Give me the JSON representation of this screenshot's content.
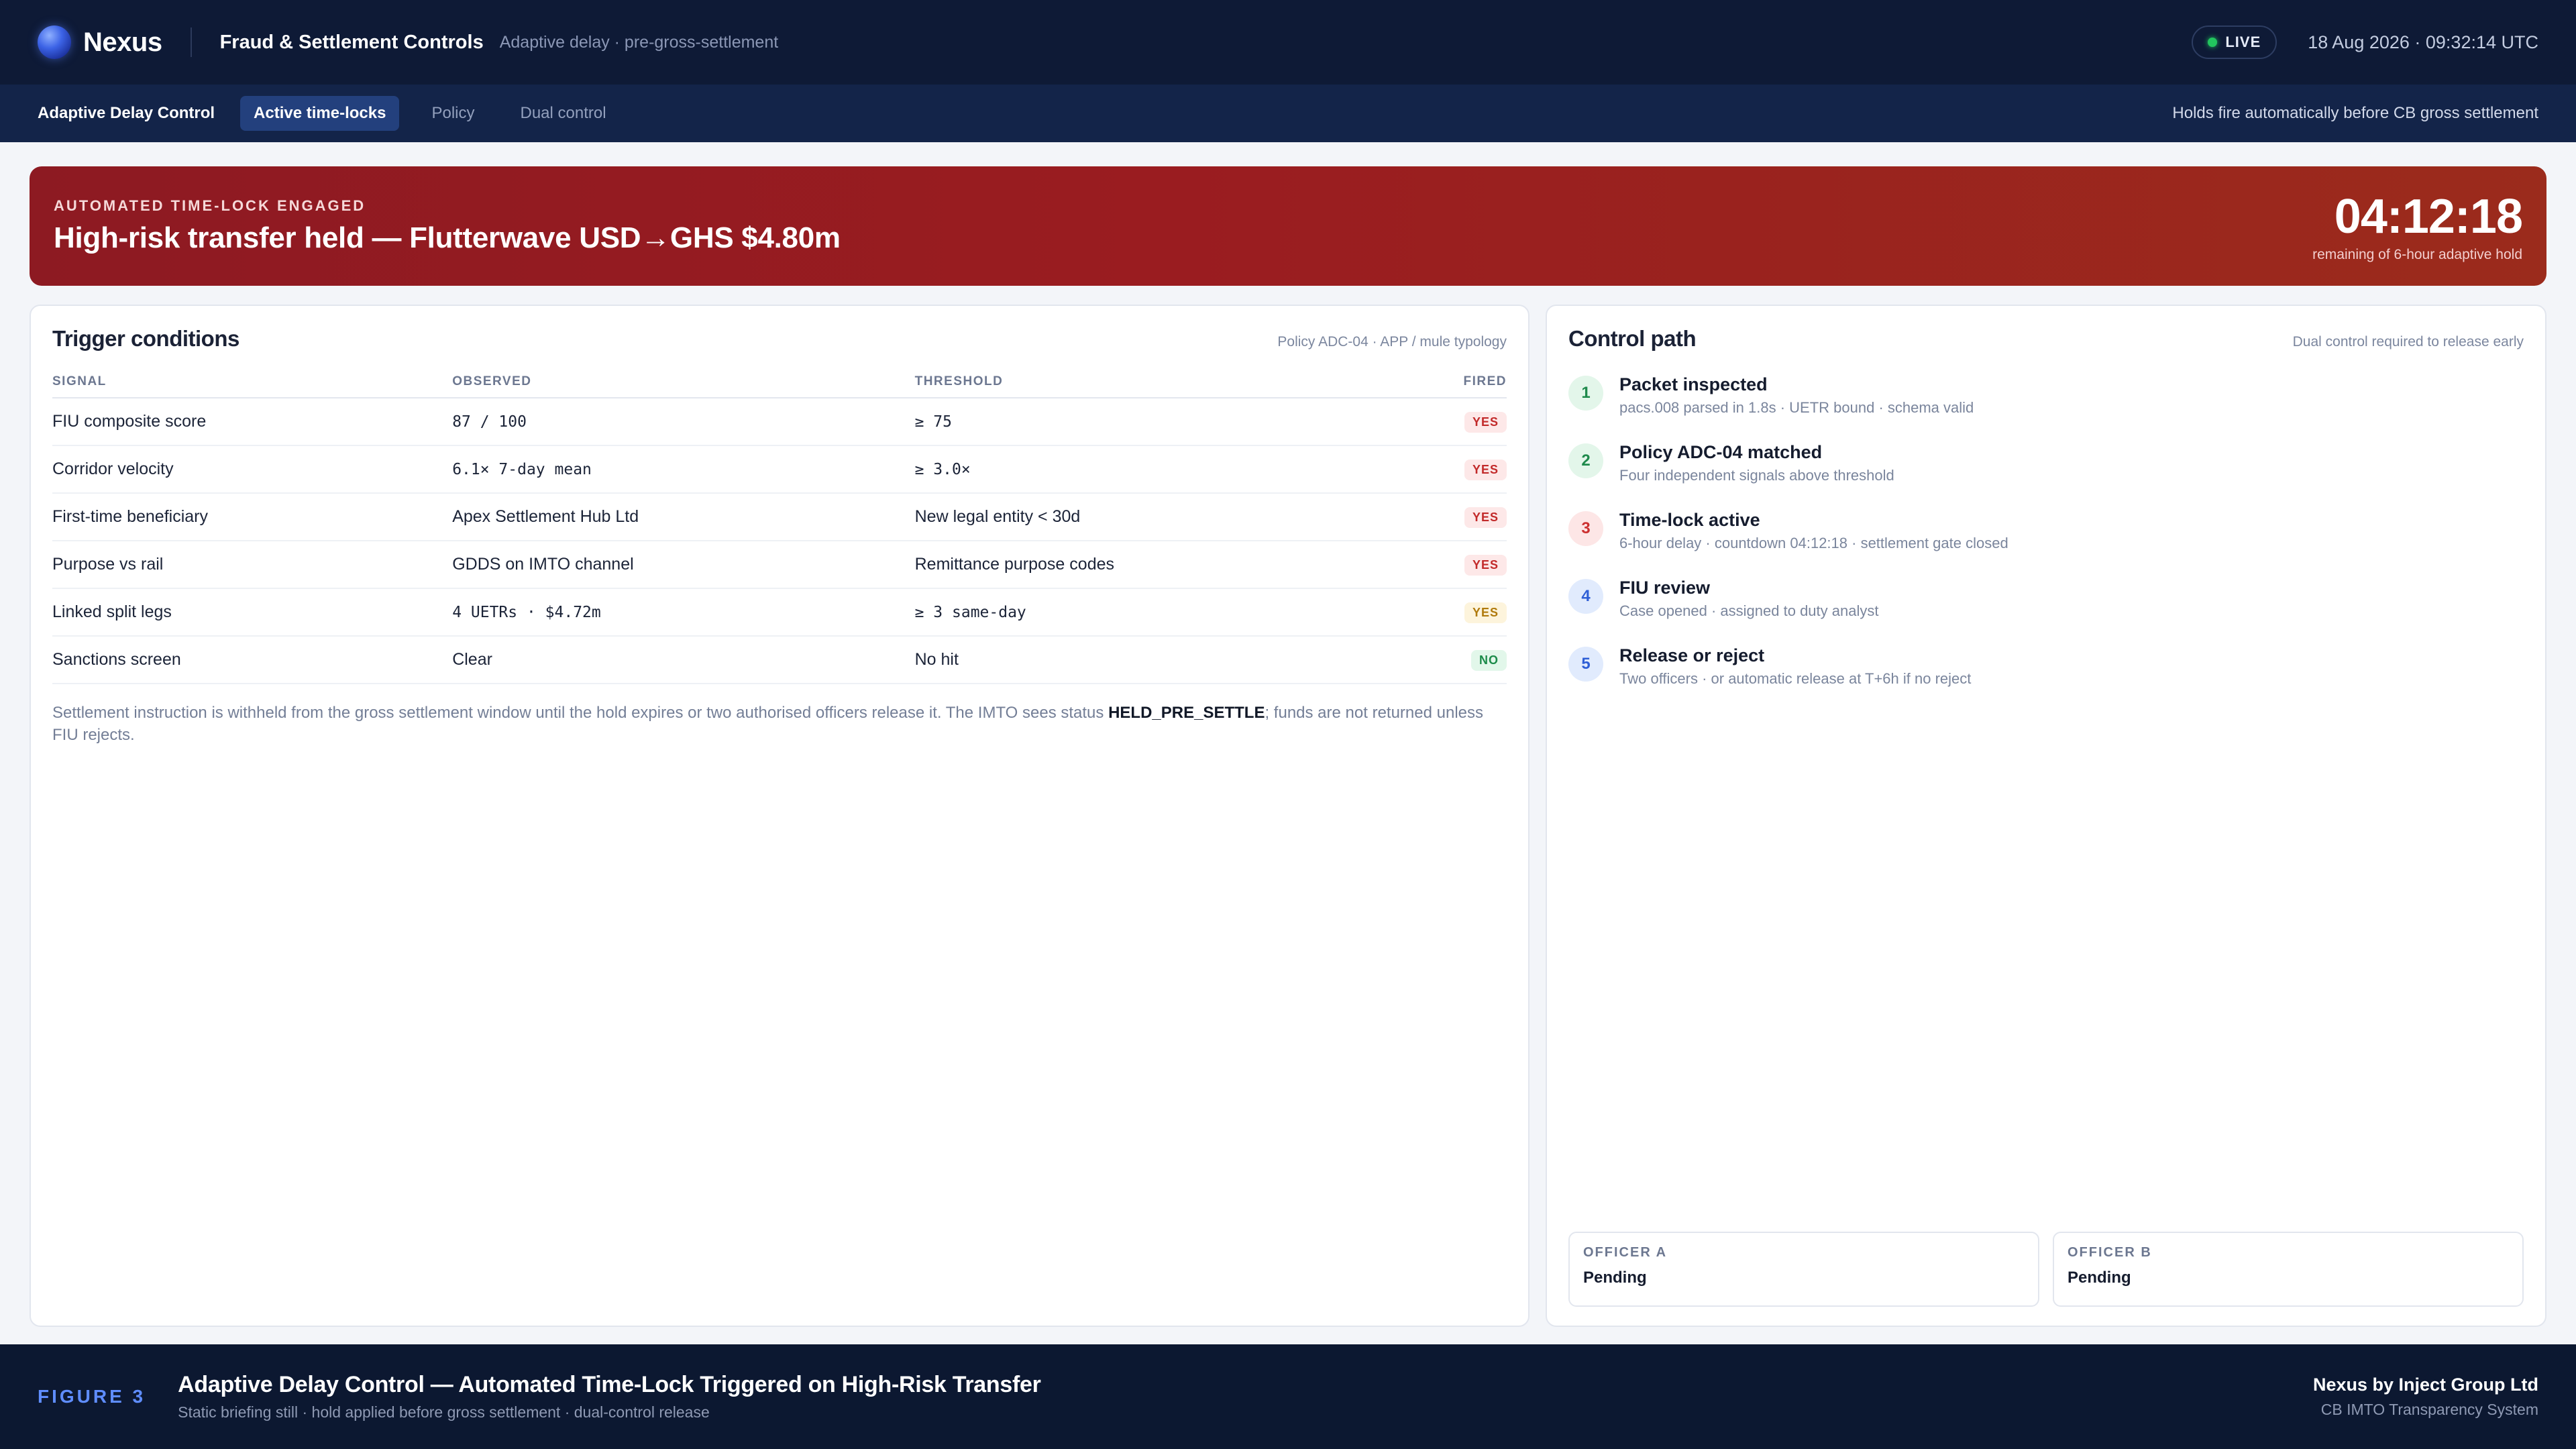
{
  "header": {
    "brand": "Nexus",
    "app_title": "Fraud & Settlement Controls",
    "app_subtitle": "Adaptive delay · pre-gross-settlement",
    "live_label": "LIVE",
    "timestamp": "18 Aug 2026 · 09:32:14 UTC"
  },
  "subnav": {
    "title": "Adaptive Delay Control",
    "tabs": [
      {
        "label": "Active time-locks",
        "active": true
      },
      {
        "label": "Policy",
        "active": false
      },
      {
        "label": "Dual control",
        "active": false
      }
    ],
    "note": "Holds fire automatically before CB gross settlement"
  },
  "alert": {
    "eyebrow": "AUTOMATED TIME-LOCK ENGAGED",
    "title": "High-risk transfer held — Flutterwave USD→GHS $4.80m",
    "countdown": "04:12:18",
    "countdown_sub": "remaining of 6-hour adaptive hold",
    "colors": {
      "start": "#8d1a22",
      "end": "#9b2b1c"
    }
  },
  "triggers": {
    "title": "Trigger conditions",
    "meta": "Policy ADC-04 · APP / mule typology",
    "columns": [
      "SIGNAL",
      "OBSERVED",
      "THRESHOLD",
      "FIRED"
    ],
    "rows": [
      {
        "signal": "FIU composite score",
        "observed": "87 / 100",
        "threshold": "≥ 75",
        "fired": "YES",
        "level": "red",
        "mono_obs": true,
        "mono_thr": true
      },
      {
        "signal": "Corridor velocity",
        "observed": "6.1× 7-day mean",
        "threshold": "≥ 3.0×",
        "fired": "YES",
        "level": "red",
        "mono_obs": true,
        "mono_thr": true
      },
      {
        "signal": "First-time beneficiary",
        "observed": "Apex Settlement Hub Ltd",
        "threshold": "New legal entity < 30d",
        "fired": "YES",
        "level": "red",
        "mono_obs": false,
        "mono_thr": false
      },
      {
        "signal": "Purpose vs rail",
        "observed": "GDDS on IMTO channel",
        "threshold": "Remittance purpose codes",
        "fired": "YES",
        "level": "red",
        "mono_obs": false,
        "mono_thr": false
      },
      {
        "signal": "Linked split legs",
        "observed": "4 UETRs · $4.72m",
        "threshold": "≥ 3 same-day",
        "fired": "YES",
        "level": "amber",
        "mono_obs": true,
        "mono_thr": true
      },
      {
        "signal": "Sanctions screen",
        "observed": "Clear",
        "threshold": "No hit",
        "fired": "NO",
        "level": "green",
        "mono_obs": false,
        "mono_thr": false
      }
    ],
    "footnote_pre": "Settlement instruction is withheld from the gross settlement window until the hold expires or two authorised officers release it. The IMTO sees status ",
    "footnote_status": "HELD_PRE_SETTLE",
    "footnote_post": "; funds are not returned unless FIU rejects."
  },
  "control_path": {
    "title": "Control path",
    "meta": "Dual control required to release early",
    "steps": [
      {
        "num": "1",
        "title": "Packet inspected",
        "desc": "pacs.008 parsed in 1.8s · UETR bound · schema valid",
        "state": "green"
      },
      {
        "num": "2",
        "title": "Policy ADC-04 matched",
        "desc": "Four independent signals above threshold",
        "state": "green"
      },
      {
        "num": "3",
        "title": "Time-lock active",
        "desc": "6-hour delay · countdown 04:12:18 · settlement gate closed",
        "state": "red"
      },
      {
        "num": "4",
        "title": "FIU review",
        "desc": "Case opened · assigned to duty analyst",
        "state": "blue"
      },
      {
        "num": "5",
        "title": "Release or reject",
        "desc": "Two officers · or automatic release at T+6h if no reject",
        "state": "blue"
      }
    ],
    "officers": [
      {
        "label": "OFFICER A",
        "status": "Pending"
      },
      {
        "label": "OFFICER B",
        "status": "Pending"
      }
    ]
  },
  "footer": {
    "figure_label": "FIGURE 3",
    "title": "Adaptive Delay Control — Automated Time-Lock Triggered on High-Risk Transfer",
    "subtitle": "Static briefing still · hold applied before gross settlement · dual-control release",
    "company": "Nexus by Inject Group Ltd",
    "system": "CB IMTO Transparency System"
  }
}
